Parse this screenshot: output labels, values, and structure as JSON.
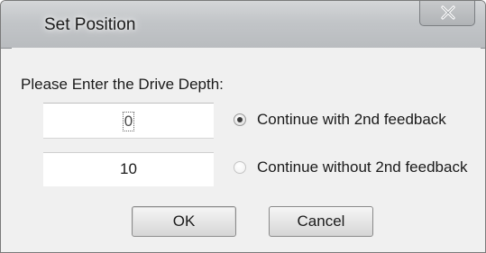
{
  "dialog": {
    "title": "Set Position",
    "prompt": "Please Enter the Drive Depth:",
    "depth_value": "0",
    "second_value": "10",
    "options": [
      {
        "label": "Continue with 2nd feedback",
        "checked": true
      },
      {
        "label": "Continue without 2nd feedback",
        "checked": false
      }
    ],
    "ok_label": "OK",
    "cancel_label": "Cancel"
  }
}
